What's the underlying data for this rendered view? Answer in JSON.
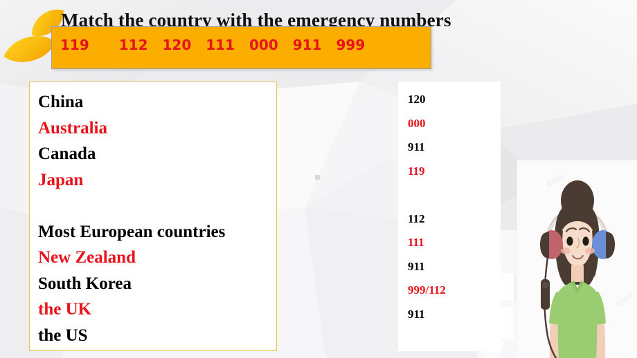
{
  "slide": {
    "title": "Match the country with the emergency numbers",
    "background_color": "#eeeef0",
    "accent_orange": "#FBAE00",
    "accent_red": "#E8121B",
    "panel_border": "#E8C44B"
  },
  "numbers_bar": {
    "numbers": [
      "119",
      "112",
      "120",
      "111",
      "000",
      "911",
      "999"
    ]
  },
  "countries": [
    {
      "label": "China",
      "color": "black"
    },
    {
      "label": "Australia",
      "color": "red"
    },
    {
      "label": "Canada",
      "color": "black"
    },
    {
      "label": "Japan",
      "color": "red"
    },
    {
      "label": "",
      "color": "black"
    },
    {
      "label": "Most European countries",
      "color": "black"
    },
    {
      "label": "New Zealand",
      "color": "red"
    },
    {
      "label": "South Korea",
      "color": "black"
    },
    {
      "label": "the UK",
      "color": "red"
    },
    {
      "label": "the US",
      "color": "black"
    }
  ],
  "answers": [
    {
      "label": "120",
      "color": "black"
    },
    {
      "label": "000",
      "color": "red"
    },
    {
      "label": "911",
      "color": "black"
    },
    {
      "label": "119",
      "color": "red"
    },
    {
      "label": "",
      "color": "black"
    },
    {
      "label": "112",
      "color": "black"
    },
    {
      "label": "111",
      "color": "red"
    },
    {
      "label": "911",
      "color": "black"
    },
    {
      "label": "999/112",
      "color": "red"
    },
    {
      "label": "911",
      "color": "black"
    }
  ],
  "character": {
    "description": "cartoon girl wearing headphones",
    "shirt_color": "#9ACD72",
    "hair_color": "#4A3C33",
    "skin_color": "#F6D7C4",
    "headphone_left_color": "#C0636B",
    "headphone_right_color": "#6A8FD6",
    "watermark": "佳得网"
  },
  "decor": {
    "leaf_color_light": "#FFD21E",
    "leaf_color_dark": "#F5A800"
  }
}
